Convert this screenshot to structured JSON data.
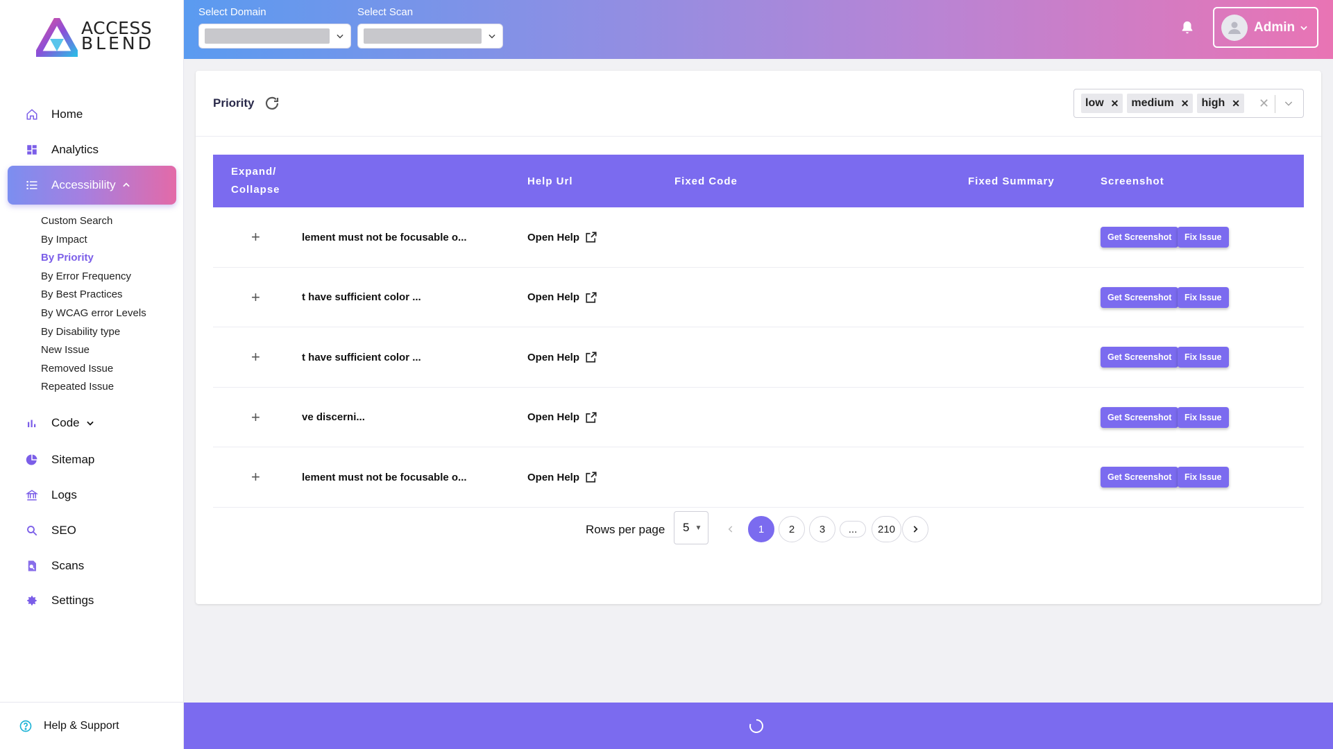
{
  "brand": {
    "line1": "ACCESS",
    "line2": "BLEND"
  },
  "sidebar": {
    "items": [
      {
        "label": "Home",
        "icon": "home-icon"
      },
      {
        "label": "Analytics",
        "icon": "dashboard-icon"
      },
      {
        "label": "Accessibility",
        "icon": "list-icon"
      },
      {
        "label": "Code",
        "icon": "bar-chart-icon"
      },
      {
        "label": "Sitemap",
        "icon": "pie-chart-icon"
      },
      {
        "label": "Logs",
        "icon": "bank-icon"
      },
      {
        "label": "SEO",
        "icon": "search-icon"
      },
      {
        "label": "Scans",
        "icon": "document-search-icon"
      },
      {
        "label": "Settings",
        "icon": "gear-icon"
      }
    ],
    "sub_items": [
      "Custom Search",
      "By Impact",
      "By Priority",
      "By Error Frequency",
      "By Best Practices",
      "By WCAG error Levels",
      "By Disability type",
      "New Issue",
      "Removed Issue",
      "Repeated Issue"
    ],
    "help": "Help & Support"
  },
  "header": {
    "domain_label": "Select Domain",
    "scan_label": "Select Scan",
    "admin_label": "Admin"
  },
  "card": {
    "title": "Priority",
    "filters": [
      "low",
      "medium",
      "high"
    ]
  },
  "table": {
    "headers": {
      "expand": "Expand/ Collapse",
      "help_url": "Help Url",
      "fixed_code": "Fixed Code",
      "fixed_summary": "Fixed Summary",
      "screenshot": "Screenshot"
    },
    "rows": [
      {
        "description": "lement must not be focusable o...",
        "help": "Open Help",
        "shot_btn": "Get Screenshot",
        "fix_btn": "Fix Issue"
      },
      {
        "description": "t have sufficient color ...",
        "help": "Open Help",
        "shot_btn": "Get Screenshot",
        "fix_btn": "Fix Issue"
      },
      {
        "description": "t have sufficient color ...",
        "help": "Open Help",
        "shot_btn": "Get Screenshot",
        "fix_btn": "Fix Issue"
      },
      {
        "description": "ve discerni...",
        "help": "Open Help",
        "shot_btn": "Get Screenshot",
        "fix_btn": "Fix Issue"
      },
      {
        "description": "lement must not be focusable o...",
        "help": "Open Help",
        "shot_btn": "Get Screenshot",
        "fix_btn": "Fix Issue"
      }
    ]
  },
  "pagination": {
    "rows_per_page_label": "Rows per page",
    "rows_per_page": "5",
    "pages": [
      "1",
      "2",
      "3",
      "...",
      "210"
    ],
    "current": "1"
  },
  "colors": {
    "accent": "#7b6bef",
    "active_text": "#7b5ee8"
  }
}
